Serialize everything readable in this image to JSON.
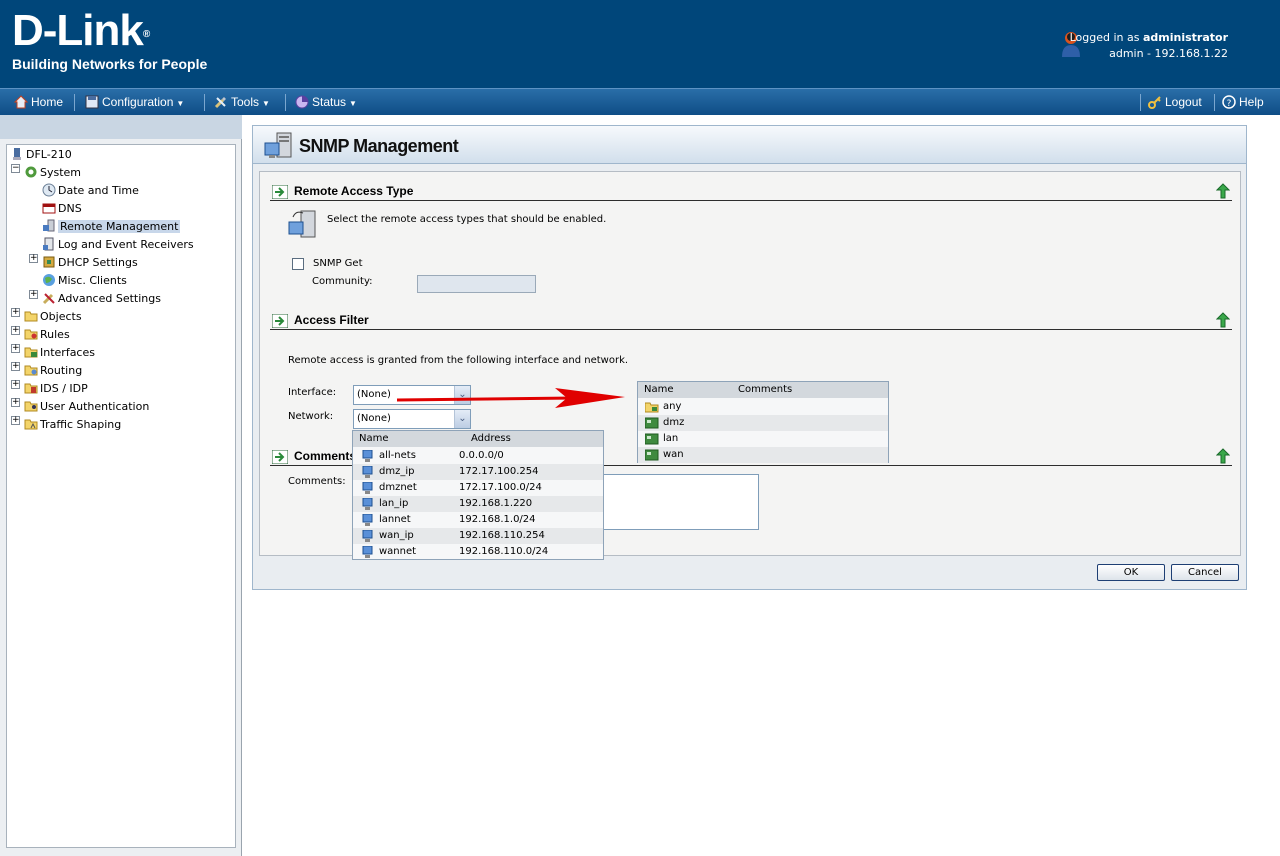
{
  "header": {
    "brand": "D-Link",
    "brand_mark": "®",
    "tagline": "Building Networks for People",
    "logged_in_prefix": "Logged in as",
    "user": "administrator",
    "session": "admin - 192.168.1.22"
  },
  "nav": {
    "home": "Home",
    "configuration": "Configuration",
    "tools": "Tools",
    "status": "Status",
    "logout": "Logout",
    "help": "Help"
  },
  "tree": {
    "root": "DFL-210",
    "system": "System",
    "date_time": "Date and Time",
    "dns": "DNS",
    "remote_management": "Remote Management",
    "log_receivers": "Log and Event Receivers",
    "dhcp_settings": "DHCP Settings",
    "misc_clients": "Misc. Clients",
    "advanced_settings": "Advanced Settings",
    "objects": "Objects",
    "rules": "Rules",
    "interfaces": "Interfaces",
    "routing": "Routing",
    "ids_idp": "IDS / IDP",
    "user_authentication": "User Authentication",
    "traffic_shaping": "Traffic Shaping"
  },
  "page": {
    "title": "SNMP Management",
    "remote_access": {
      "heading": "Remote Access Type",
      "description": "Select the remote access types that should be enabled.",
      "snmp_get_label": "SNMP Get",
      "snmp_get_checked": false,
      "community_label": "Community:",
      "community_value": ""
    },
    "access_filter": {
      "heading": "Access Filter",
      "description": "Remote access is granted from the following interface and network.",
      "interface_label": "Interface:",
      "interface_value": "(None)",
      "network_label": "Network:",
      "network_value": "(None)"
    },
    "comments": {
      "heading": "Comments",
      "label": "Comments:",
      "value": ""
    },
    "ok_label": "OK",
    "cancel_label": "Cancel"
  },
  "network_dropdown": {
    "columns": [
      "Name",
      "Address"
    ],
    "rows": [
      {
        "name": "all-nets",
        "address": "0.0.0.0/0"
      },
      {
        "name": "dmz_ip",
        "address": "172.17.100.254"
      },
      {
        "name": "dmznet",
        "address": "172.17.100.0/24"
      },
      {
        "name": "lan_ip",
        "address": "192.168.1.220"
      },
      {
        "name": "lannet",
        "address": "192.168.1.0/24"
      },
      {
        "name": "wan_ip",
        "address": "192.168.110.254"
      },
      {
        "name": "wannet",
        "address": "192.168.110.0/24"
      }
    ]
  },
  "interface_dropdown": {
    "columns": [
      "Name",
      "Comments"
    ],
    "rows": [
      {
        "name": "any",
        "comments": "",
        "icon": "folder-icon"
      },
      {
        "name": "dmz",
        "comments": "",
        "icon": "network-card-icon"
      },
      {
        "name": "lan",
        "comments": "",
        "icon": "network-card-icon"
      },
      {
        "name": "wan",
        "comments": "",
        "icon": "network-card-icon"
      }
    ]
  },
  "colors": {
    "header_bg": "#00467a",
    "nav_bg": "#1a5e99",
    "annotation_arrow": "#e00000"
  }
}
